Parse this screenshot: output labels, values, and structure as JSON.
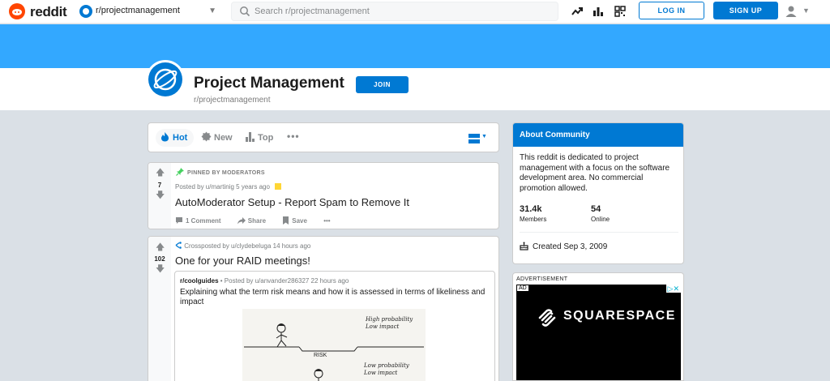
{
  "header": {
    "brand": "reddit",
    "community": "r/projectmanagement",
    "search_placeholder": "Search r/projectmanagement",
    "login_label": "LOG IN",
    "signup_label": "SIGN UP"
  },
  "subreddit": {
    "title": "Project Management",
    "name": "r/projectmanagement",
    "join_label": "JOIN"
  },
  "sortbar": {
    "hot": "Hot",
    "new": "New",
    "top": "Top",
    "more": "•••"
  },
  "posts": [
    {
      "pinned_label": "PINNED BY MODERATORS",
      "votes": "7",
      "meta": "Posted by u/martinig 5 years ago",
      "title": "AutoModerator Setup - Report Spam to Remove It",
      "comments": "1 Comment",
      "share": "Share",
      "save": "Save",
      "more": "•••"
    },
    {
      "votes": "102",
      "meta": "Crossposted by u/clydebeluga 14 hours ago",
      "title": "One for your RAID meetings!",
      "crosspost": {
        "subreddit": "r/coolguides",
        "meta": " • Posted by u/anvander286327 22 hours ago",
        "title": "Explaining what the term risk means and how it is assessed in terms of likeliness and impact",
        "image_text": {
          "high_prob": "High probability",
          "low_impact_1": "Low impact",
          "risk": "RISK",
          "low_prob": "Low probability",
          "low_impact_2": "Low impact"
        }
      }
    }
  ],
  "about": {
    "heading": "About Community",
    "description": "This reddit is dedicated to project management with a focus on the software development area. No commercial promotion allowed.",
    "members_count": "31.4k",
    "members_label": "Members",
    "online_count": "54",
    "online_label": "Online",
    "created": "Created Sep 3, 2009"
  },
  "ad": {
    "label": "ADVERTISEMENT",
    "tag": "AD",
    "brand": "SQUARESPACE"
  },
  "colors": {
    "accent": "#0079d3",
    "banner": "#33a8ff",
    "brand": "#ff4500",
    "background": "#dae0e6"
  }
}
